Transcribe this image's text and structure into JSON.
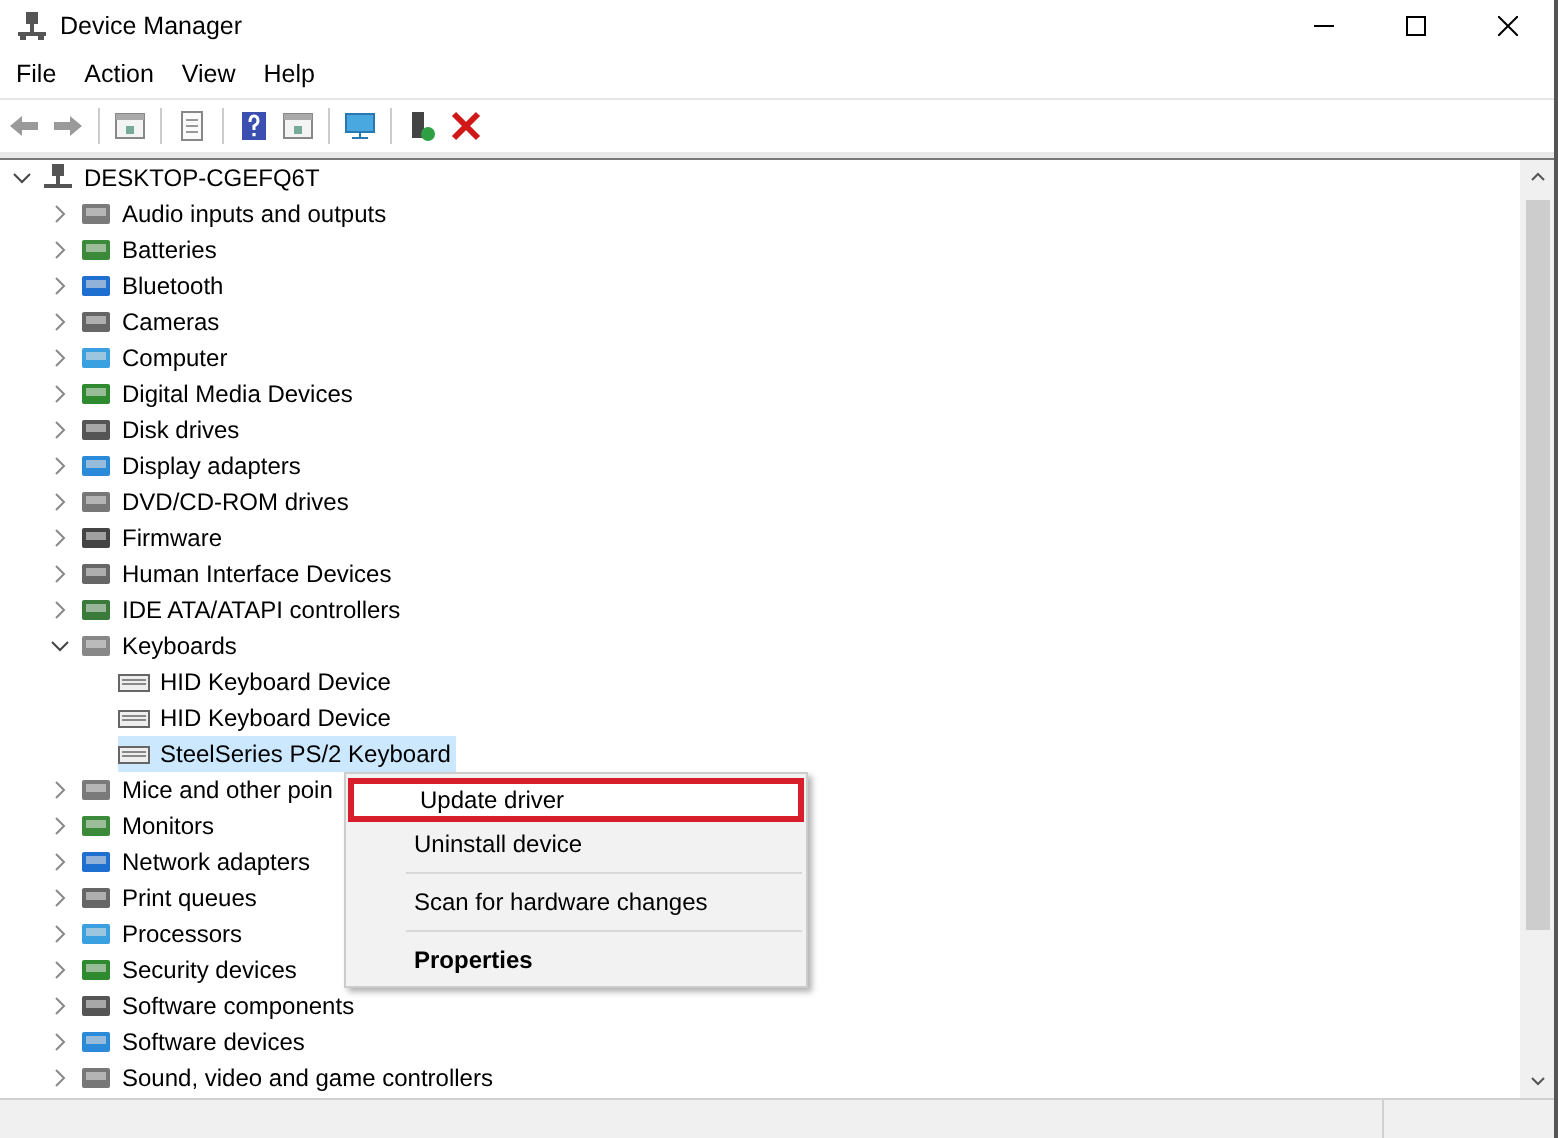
{
  "window": {
    "title": "Device Manager"
  },
  "menu": [
    "File",
    "Action",
    "View",
    "Help"
  ],
  "tree": [
    {
      "label": "DESKTOP-CGEFQ6T",
      "expanded": true,
      "selected": false,
      "children": [
        {
          "label": "Audio inputs and outputs",
          "expanded": false,
          "selected": false
        },
        {
          "label": "Batteries",
          "expanded": false,
          "selected": false
        },
        {
          "label": "Bluetooth",
          "expanded": false,
          "selected": false
        },
        {
          "label": "Cameras",
          "expanded": false,
          "selected": false
        },
        {
          "label": "Computer",
          "expanded": false,
          "selected": false
        },
        {
          "label": "Digital Media Devices",
          "expanded": false,
          "selected": false
        },
        {
          "label": "Disk drives",
          "expanded": false,
          "selected": false
        },
        {
          "label": "Display adapters",
          "expanded": false,
          "selected": false
        },
        {
          "label": "DVD/CD-ROM drives",
          "expanded": false,
          "selected": false
        },
        {
          "label": "Firmware",
          "expanded": false,
          "selected": false
        },
        {
          "label": "Human Interface Devices",
          "expanded": false,
          "selected": false
        },
        {
          "label": "IDE ATA/ATAPI controllers",
          "expanded": false,
          "selected": false
        },
        {
          "label": "Keyboards",
          "expanded": true,
          "selected": false,
          "children": [
            {
              "label": "HID Keyboard Device",
              "selected": false
            },
            {
              "label": "HID Keyboard Device",
              "selected": false
            },
            {
              "label": "SteelSeries PS/2 Keyboard",
              "selected": true
            }
          ]
        },
        {
          "label": "Mice and other poin",
          "expanded": false,
          "selected": false
        },
        {
          "label": "Monitors",
          "expanded": false,
          "selected": false
        },
        {
          "label": "Network adapters",
          "expanded": false,
          "selected": false
        },
        {
          "label": "Print queues",
          "expanded": false,
          "selected": false
        },
        {
          "label": "Processors",
          "expanded": false,
          "selected": false
        },
        {
          "label": "Security devices",
          "expanded": false,
          "selected": false
        },
        {
          "label": "Software components",
          "expanded": false,
          "selected": false
        },
        {
          "label": "Software devices",
          "expanded": false,
          "selected": false
        },
        {
          "label": "Sound, video and game controllers",
          "expanded": false,
          "selected": false
        }
      ]
    }
  ],
  "context_menu": [
    {
      "label": "Update driver",
      "selected": true,
      "bold": false
    },
    {
      "label": "Uninstall device",
      "selected": false,
      "bold": false
    },
    {
      "kind": "separator"
    },
    {
      "label": "Scan for hardware changes",
      "selected": false,
      "bold": false
    },
    {
      "kind": "separator"
    },
    {
      "label": "Properties",
      "selected": false,
      "bold": true
    }
  ]
}
